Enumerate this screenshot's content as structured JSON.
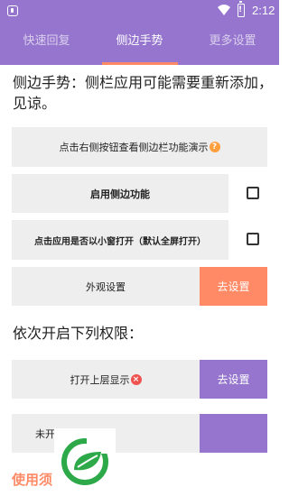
{
  "status_bar": {
    "time": "2:12",
    "battery_glyph": "!"
  },
  "tabs": [
    {
      "label": "快速回复",
      "active": false
    },
    {
      "label": "侧边手势",
      "active": true
    },
    {
      "label": "更多设置",
      "active": false
    }
  ],
  "heading": "侧边手势：侧栏应用可能需要重新添加，见谅。",
  "demo_button": {
    "label": "点击右侧按钮查看侧边栏功能演示",
    "icon": "help-icon"
  },
  "enable_sidebar": {
    "label": "启用侧边功能",
    "checked": false
  },
  "window_mode": {
    "label": "点击应用是否以小窗打开（默认全屏打开）",
    "checked": false
  },
  "appearance": {
    "label": "外观设置",
    "button": "去设置"
  },
  "permissions_heading": "依次开启下列权限：",
  "overlay_permission": {
    "label": "打开上层显示",
    "button": "去设置",
    "status_icon": "error-icon"
  },
  "next_permission": {
    "label": "未开",
    "button": ""
  },
  "bottom_text": "使用须",
  "colors": {
    "primary": "#9575cd",
    "accent": "#ff8a65",
    "panel": "#eeeeee",
    "help": "#ff9e3d",
    "error": "#ef5350",
    "logo": "#2ea94a"
  }
}
